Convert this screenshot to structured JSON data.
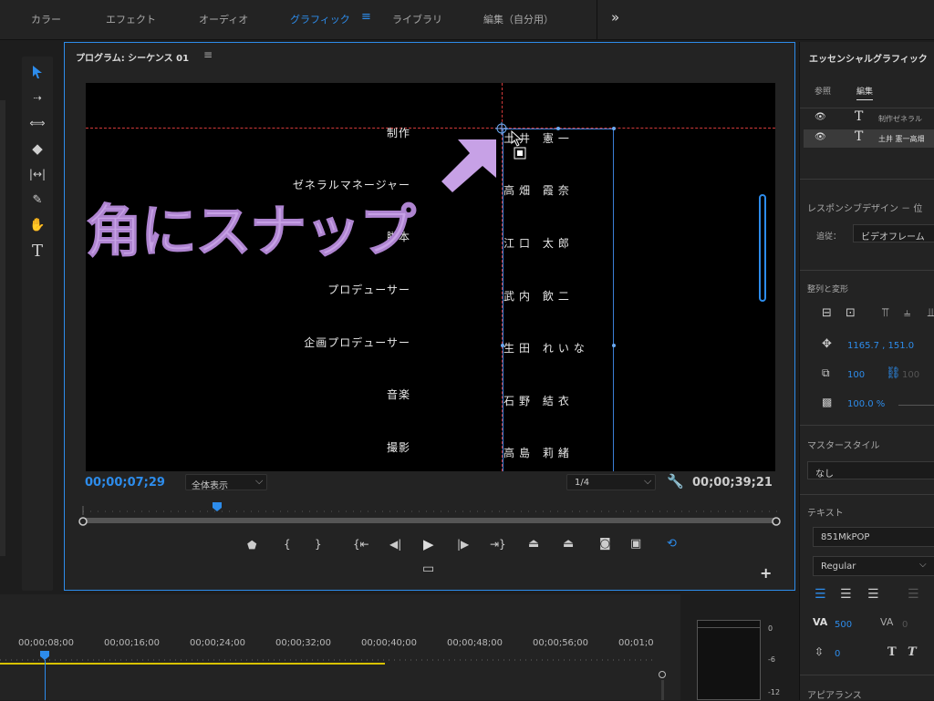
{
  "workspace_tabs": [
    {
      "label": "カラー"
    },
    {
      "label": "エフェクト"
    },
    {
      "label": "オーディオ"
    },
    {
      "label": "グラフィック",
      "active": true
    },
    {
      "label": "ライブラリ"
    },
    {
      "label": "編集（自分用）"
    }
  ],
  "program": {
    "title": "プログラム: シーケンス 01",
    "timecode_current": "00;00;07;29",
    "fit_label": "全体表示",
    "resolution": "1/4",
    "timecode_duration": "00;00;39;21"
  },
  "overlay_caption": "角にスナップ",
  "credits": [
    {
      "role": "制作",
      "name": "土井 憲一"
    },
    {
      "role": "ゼネラルマネージャー",
      "name": "高畑 霞奈"
    },
    {
      "role": "脚本",
      "name": "江口 太郎"
    },
    {
      "role": "プロデューサー",
      "name": "武内 飲二"
    },
    {
      "role": "企画プロデューサー",
      "name": "生田 れいな"
    },
    {
      "role": "音楽",
      "name": "石野 結衣"
    },
    {
      "role": "撮影",
      "name": "高島 莉緒"
    }
  ],
  "timeline": {
    "ruler_labels": [
      "00;00;08;00",
      "00;00;16;00",
      "00;00;24;00",
      "00;00;32;00",
      "00;00;40;00",
      "00;00;48;00",
      "00;00;56;00",
      "00;01;0"
    ]
  },
  "meter_labels": [
    "0",
    "-6",
    "-12"
  ],
  "essential_graphics": {
    "title": "エッセンシャルグラフィック",
    "tabs": [
      "参照",
      "編集"
    ],
    "layers": [
      {
        "label": "制作ゼネラル"
      },
      {
        "label": "土井 憲一高畑"
      }
    ],
    "responsive_label": "レスポンシブデザイン － 位",
    "follow_label": "追従：",
    "follow_value": "ビデオフレーム",
    "align_label": "整列と変形",
    "position_value": "1165.7 ,  151.0",
    "scale_value": "100",
    "scale_value2": "100",
    "opacity_value": "100.0 %",
    "master_style_label": "マスタースタイル",
    "master_style_value": "なし",
    "text_label": "テキスト",
    "font_value": "851MkPOP",
    "font_style": "Regular",
    "kerning_value": "500",
    "tracking_value": "0",
    "leading_value": "0",
    "appearance_label": "アピアランス"
  },
  "colors": {
    "accent": "#2d8ceb",
    "caption": "#c7a1e6",
    "guide": "#d23a3a"
  }
}
